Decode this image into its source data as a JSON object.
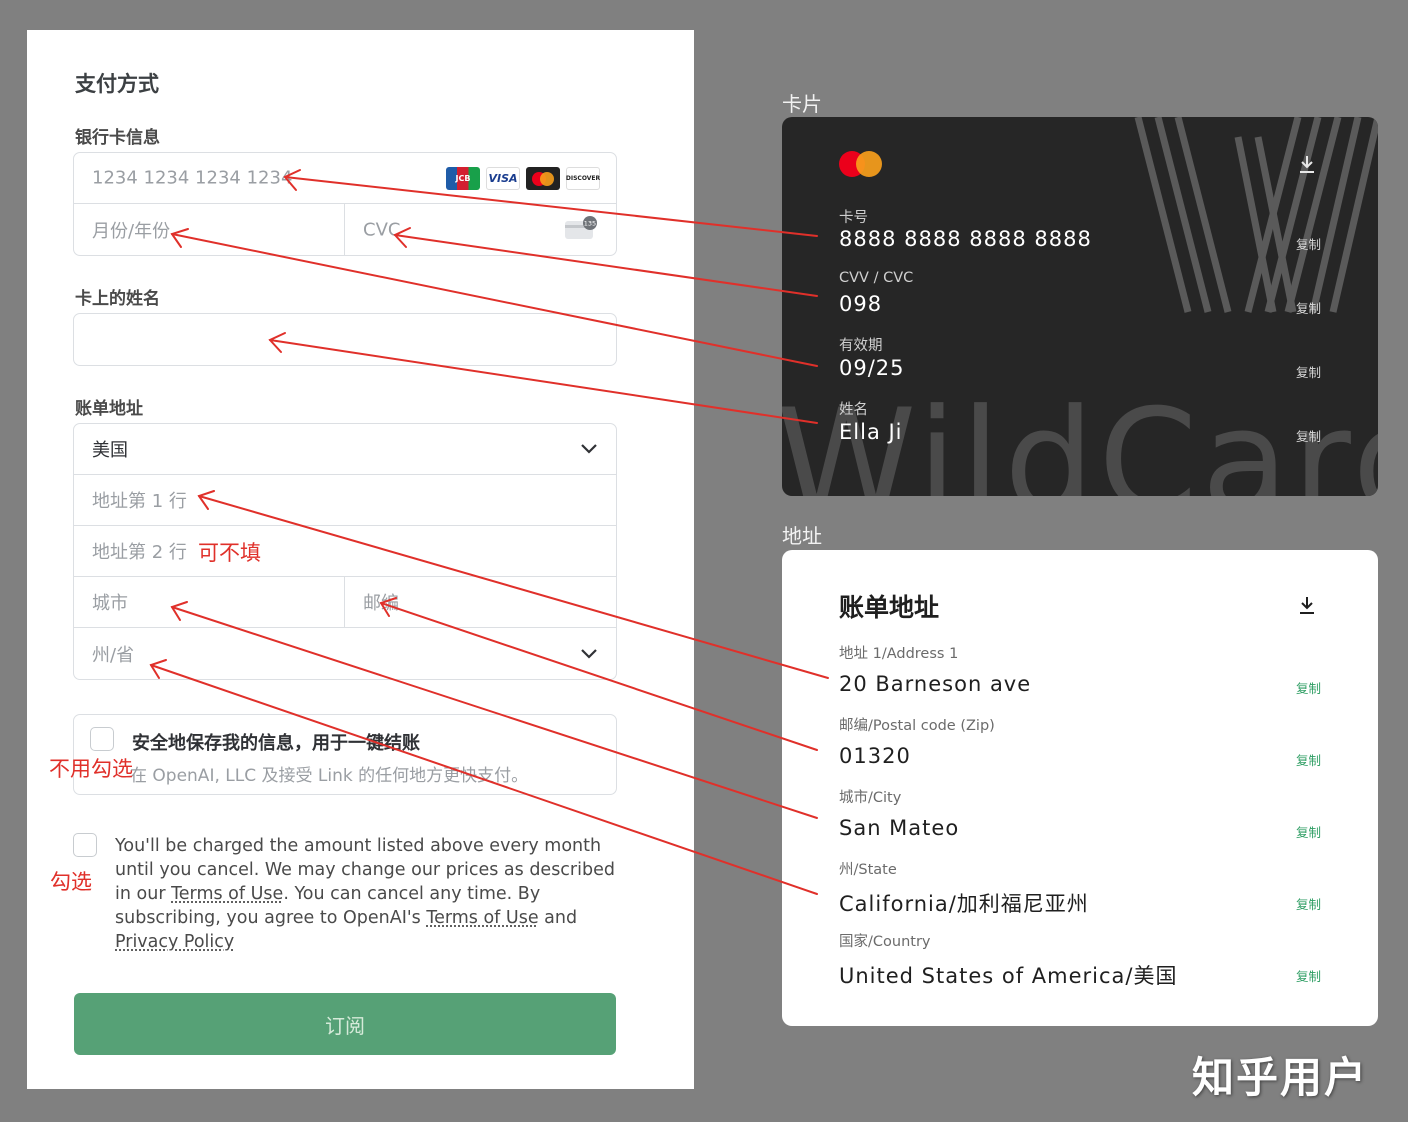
{
  "form": {
    "title": "支付方式",
    "card_section_label": "银行卡信息",
    "card_number_placeholder": "1234 1234 1234 1234",
    "expiry_placeholder": "月份/年份",
    "cvc_placeholder": "CVC",
    "name_section_label": "卡上的姓名",
    "name_value": "",
    "billing_section_label": "账单地址",
    "country_value": "美国",
    "address1_placeholder": "地址第 1 行",
    "address2_placeholder": "地址第 2 行",
    "city_placeholder": "城市",
    "zip_placeholder": "邮编",
    "state_placeholder": "州/省",
    "save_title": "安全地保存我的信息，用于一键结账",
    "save_subtitle": "在 OpenAI, LLC 及接受 Link 的任何地方更快支付。",
    "terms_part1": "You'll be charged the amount listed above every month until you cancel. We may change our prices as described in our ",
    "terms_link1": "Terms of Use",
    "terms_part2": ". You can cancel any time. By subscribing, you agree to OpenAI's ",
    "terms_link2": "Terms of Use",
    "terms_part3": " and ",
    "terms_link3": "Privacy Policy",
    "subscribe_label": "订阅",
    "card_brands": [
      "JCB",
      "VISA",
      "Mastercard",
      "DISCOVER"
    ],
    "cvc_badge": "135"
  },
  "notes": {
    "optional": "可不填",
    "dont_check": "不用勾选",
    "check": "勾选"
  },
  "card_panel": {
    "label": "卡片",
    "number_label": "卡号",
    "number": "8888 8888 8888 8888",
    "cvv_label": "CVV / CVC",
    "cvv": "098",
    "expiry_label": "有效期",
    "expiry": "09/25",
    "name_label": "姓名",
    "name": "Ella Ji",
    "copy_label": "复制",
    "watermark": "WildCard"
  },
  "address_panel": {
    "label": "地址",
    "title": "账单地址",
    "address1_label": "地址 1/Address 1",
    "address1": "20 Barneson ave",
    "zip_label": "邮编/Postal code (Zip)",
    "zip": "01320",
    "city_label": "城市/City",
    "city": "San Mateo",
    "state_label": "州/State",
    "state": "California/加利福尼亚州",
    "country_label": "国家/Country",
    "country": "United States of America/美国",
    "copy_label": "复制"
  },
  "watermark": "知乎用户",
  "colors": {
    "accent_green": "#56a176",
    "copy_green": "#2f9e64",
    "annotation_red": "#e0302a",
    "card_bg": "#262626"
  }
}
